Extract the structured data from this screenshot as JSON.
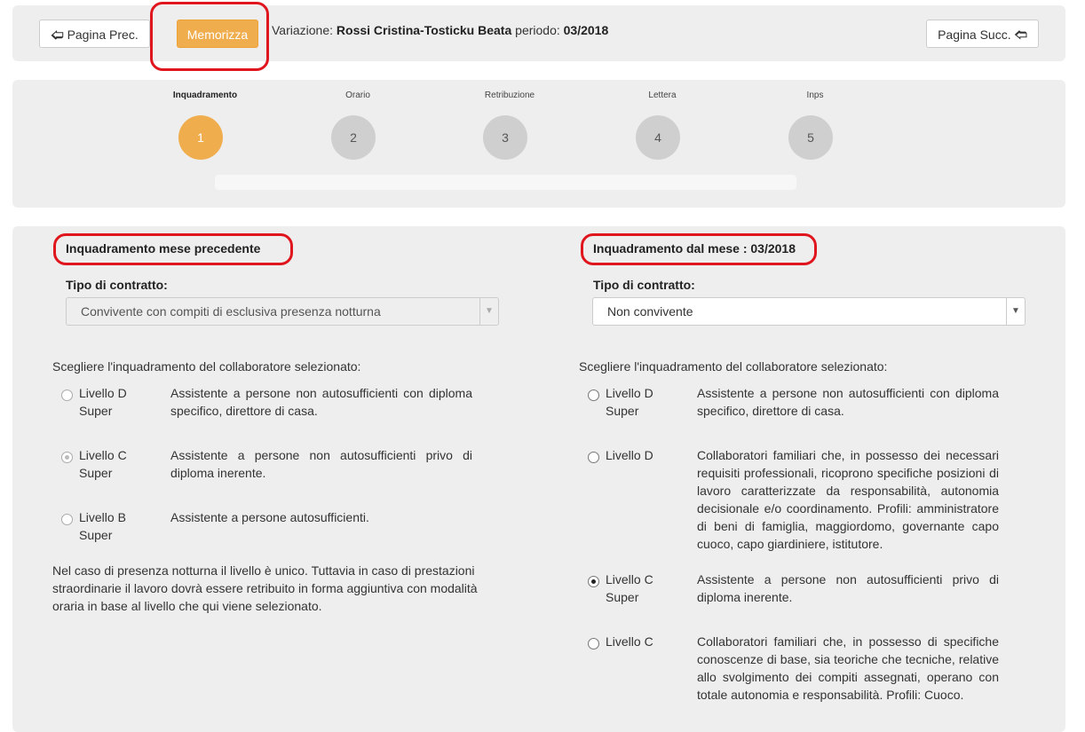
{
  "toolbar": {
    "prev_label": "Pagina Prec.",
    "save_label": "Memorizza",
    "next_label": "Pagina Succ.",
    "variazione_prefix": "Variazione: ",
    "employee": "Rossi Cristina-Tosticku Beata",
    "periodo_prefix": " periodo: ",
    "periodo": "03/2018"
  },
  "steps": [
    {
      "label": "Inquadramento",
      "number": "1"
    },
    {
      "label": "Orario",
      "number": "2"
    },
    {
      "label": "Retribuzione",
      "number": "3"
    },
    {
      "label": "Lettera",
      "number": "4"
    },
    {
      "label": "Inps",
      "number": "5"
    }
  ],
  "left": {
    "title": "Inquadramento mese precedente",
    "contract_label": "Tipo di contratto:",
    "contract_value": "Convivente con compiti di esclusiva presenza notturna",
    "instruction": "Scegliere l'inquadramento del collaboratore selezionato:",
    "levels": [
      {
        "line1": "Livello D",
        "line2": "Super",
        "desc": "Assistente a persone non autosufficienti con diploma specifico, direttore di casa."
      },
      {
        "line1": "Livello C",
        "line2": "Super",
        "desc": "Assistente a persone non autosufficienti privo di diploma inerente."
      },
      {
        "line1": "Livello B",
        "line2": "Super",
        "desc": "Assistente a persone autosufficienti."
      }
    ],
    "note": "Nel caso di presenza notturna il livello è unico. Tuttavia in caso di prestazioni straordinarie il lavoro dovrà essere retribuito in forma aggiuntiva con modalità oraria in base al livello che qui viene selezionato."
  },
  "right": {
    "title": "Inquadramento dal mese : 03/2018",
    "contract_label": "Tipo di contratto:",
    "contract_value": "Non convivente",
    "instruction": "Scegliere l'inquadramento del collaboratore selezionato:",
    "levels": [
      {
        "line1": "Livello D",
        "line2": "Super",
        "desc": "Assistente a persone non autosufficienti con diploma specifico, direttore di casa."
      },
      {
        "line1": "Livello D",
        "line2": "",
        "desc": "Collaboratori familiari che, in possesso dei necessari requisiti professionali, ricoprono specifiche posizioni di lavoro caratterizzate da responsabilità, autonomia decisionale e/o coordinamento. Profili: amministratore di beni di famiglia, maggiordomo, governante capo cuoco, capo giardiniere, istitutore."
      },
      {
        "line1": "Livello C",
        "line2": "Super",
        "desc": "Assistente a persone non autosufficienti privo di diploma inerente."
      },
      {
        "line1": "Livello C",
        "line2": "",
        "desc": "Collaboratori familiari che, in possesso di specifiche conoscenze di base, sia teoriche che tecniche, relative allo svolgimento dei compiti assegnati, operano con totale autonomia e responsabilità. Profili: Cuoco."
      }
    ]
  },
  "state": {
    "active_step": 1,
    "left_selected_level": 1,
    "right_selected_level": 2
  },
  "colors": {
    "accent": "#f0ad4e",
    "highlight": "#e0161e",
    "panel": "#eeeeee"
  }
}
